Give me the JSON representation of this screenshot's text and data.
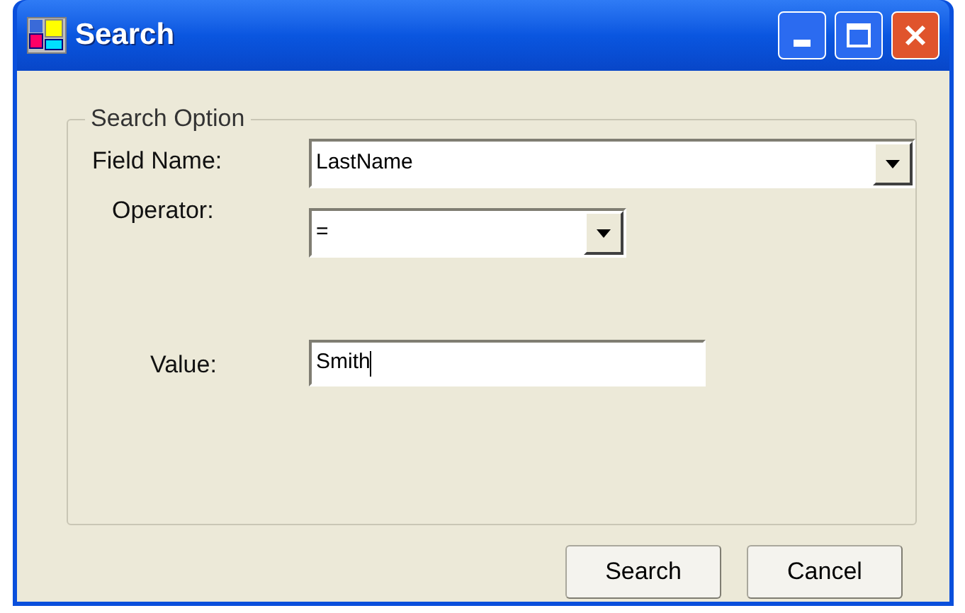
{
  "window": {
    "title": "Search"
  },
  "group": {
    "legend": "Search Option"
  },
  "fields": [
    {
      "kind": "dropdown",
      "label": "Field Name:",
      "value": "LastName"
    },
    {
      "kind": "dropdown",
      "label": "Operator:",
      "value": "="
    },
    {
      "kind": "text",
      "label": "Value:",
      "value": "Smith",
      "focused": true
    }
  ],
  "buttons": [
    "Search",
    "Cancel"
  ]
}
